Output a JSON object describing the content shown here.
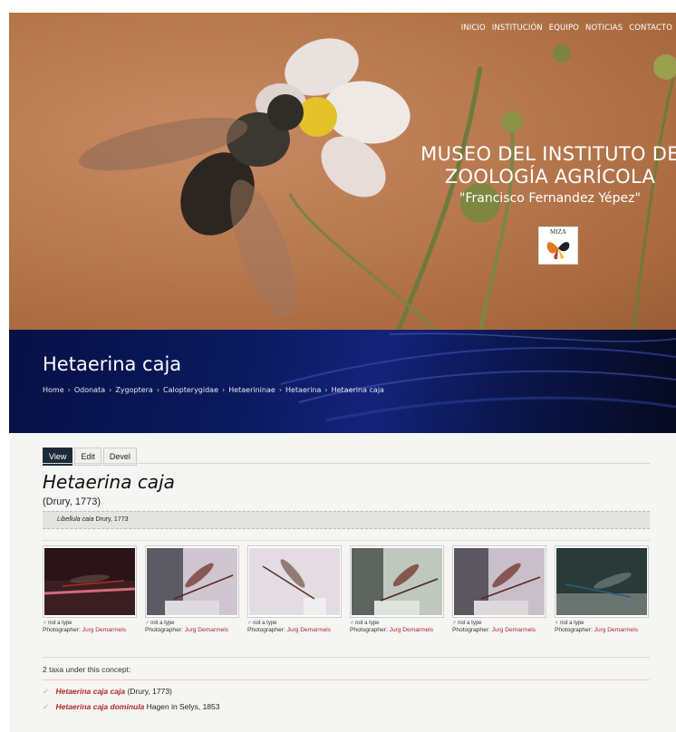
{
  "nav": [
    "INICIO",
    "INSTITUCIÓN",
    "EQUIPO",
    "NOTICIAS",
    "CONTACTO"
  ],
  "hero": {
    "title_line1": "MUSEO DEL INSTITUTO DE",
    "title_line2": "ZOOLOGÍA AGRÍCOLA",
    "subtitle": "\"Francisco Fernandez Yépez\"",
    "logo_text": "MIZA"
  },
  "page": {
    "title": "Hetaerina caja",
    "breadcrumb": [
      "Home",
      "Odonata",
      "Zygoptera",
      "Calopterygidae",
      "Hetaerininae",
      "Hetaerina",
      "Hetaerina caja"
    ],
    "breadcrumb_sep": "›"
  },
  "tabs": [
    "View",
    "Edit",
    "Devel"
  ],
  "species": {
    "name": "Hetaerina caja",
    "author": "(Drury, 1773)",
    "synonym_name": "Libellula caia",
    "synonym_author": "Drury, 1773"
  },
  "gallery": [
    {
      "sex": "♂ not a type",
      "label": "Photographer:",
      "photographer": "Jurg Demarmels"
    },
    {
      "sex": "♂ not a type",
      "label": "Photographer:",
      "photographer": "Jurg Demarmels"
    },
    {
      "sex": "♂ not a type",
      "label": "Photographer:",
      "photographer": "Jurg Demarmels"
    },
    {
      "sex": "♂ not a type",
      "label": "Photographer:",
      "photographer": "Jurg Demarmels"
    },
    {
      "sex": "♂ not a type",
      "label": "Photographer:",
      "photographer": "Jurg Demarmels"
    },
    {
      "sex": "♀ not a type",
      "label": "Photographer:",
      "photographer": "Jurg Demarmels"
    }
  ],
  "taxa": {
    "count_text": "2 taxa under this concept:",
    "items": [
      {
        "name": "Hetaerina caja caja",
        "author": "(Drury, 1773)"
      },
      {
        "name": "Hetaerina caja dominula",
        "author": "Hagen in Selys, 1853"
      }
    ]
  },
  "colors": {
    "link": "#b0282a",
    "tab_active": "#1c2b3a",
    "banner": "#0a1a5e"
  }
}
